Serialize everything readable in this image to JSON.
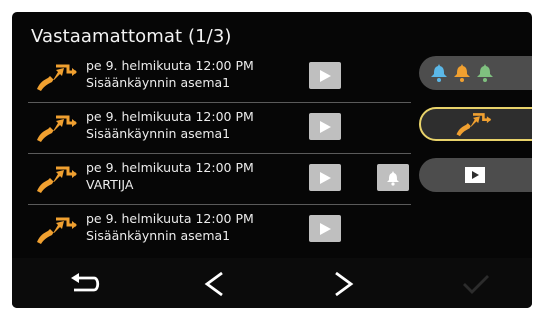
{
  "header": {
    "title": "Vastaamattomat (1/3)"
  },
  "calls": [
    {
      "date": "pe 9. helmikuuta 12:00 PM",
      "name": "Sisäänkäynnin asema1",
      "has_bell": false
    },
    {
      "date": "pe 9. helmikuuta 12:00 PM",
      "name": "Sisäänkäynnin asema1",
      "has_bell": false
    },
    {
      "date": "pe 9. helmikuuta 12:00 PM",
      "name": "VARTIJA",
      "has_bell": true
    },
    {
      "date": "pe 9. helmikuuta 12:00 PM",
      "name": "Sisäänkäynnin asema1",
      "has_bell": false
    }
  ],
  "side_buttons": [
    {
      "name": "bell-filter-button",
      "icons": [
        "bell-icon",
        "bell-icon",
        "bell-icon"
      ],
      "colors": [
        "#5bb8e8",
        "#f0a030",
        "#7fc07f"
      ],
      "selected": false
    },
    {
      "name": "missed-call-filter-button",
      "icons": [
        "missed-call-icon"
      ],
      "selected": true
    },
    {
      "name": "video-playback-button",
      "icons": [
        "play-icon"
      ],
      "selected": false
    }
  ],
  "bottom_bar": {
    "back": "return-arrow-icon",
    "prev": "chevron-left-icon",
    "next": "chevron-right-icon",
    "confirm": "checkmark-icon",
    "confirm_enabled": false
  },
  "colors": {
    "background": "#060606",
    "accent_orange": "#f0a030",
    "selected_outline": "#e8d26a",
    "button_gray": "#bfbfbf"
  }
}
